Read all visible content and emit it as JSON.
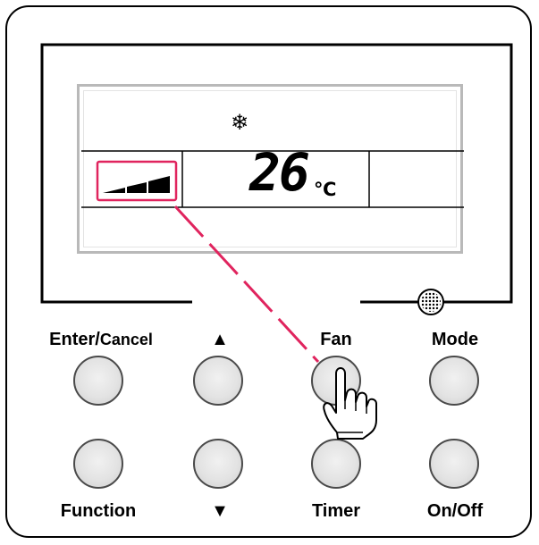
{
  "display": {
    "mode_icon": "snowflake-icon",
    "temperature": "26",
    "unit": "℃",
    "fan_speed_icon": "fan-speed-bars-icon"
  },
  "buttons": {
    "enter_cancel": {
      "label_main": "Enter/",
      "label_small": "Cancel"
    },
    "up": {
      "label": "▲"
    },
    "fan": {
      "label": "Fan"
    },
    "mode": {
      "label": "Mode"
    },
    "function": {
      "label": "Function"
    },
    "down": {
      "label": "▼"
    },
    "timer": {
      "label": "Timer"
    },
    "on_off": {
      "label": "On/Off"
    }
  },
  "annotation": {
    "highlight_color": "#e0245e",
    "pointer_icon": "hand-pointer-icon"
  }
}
